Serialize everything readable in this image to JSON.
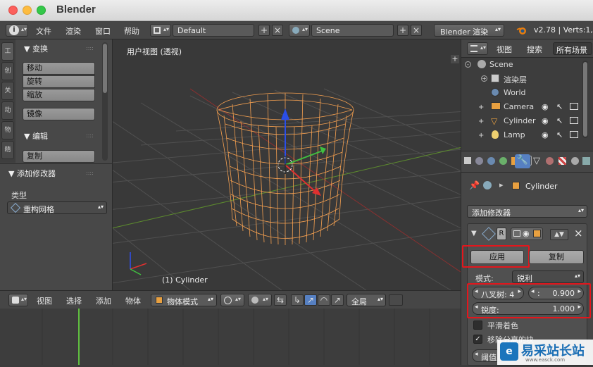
{
  "window": {
    "title": "Blender"
  },
  "info_header": {
    "menus": [
      "文件",
      "渲染",
      "窗口",
      "帮助"
    ],
    "screen_layout": "Default",
    "scene": "Scene",
    "render_engine": "Blender 渲染",
    "version_stats": "v2.78 | Verts:1,2"
  },
  "tool_shelf": {
    "tabs": [
      "工",
      "创",
      "关",
      "动",
      "物",
      "精"
    ],
    "transform_header": "变换",
    "transform_buttons": [
      "移动",
      "旋转",
      "缩放"
    ],
    "mirror_button": "镜像",
    "edit_header": "编辑",
    "duplicate_button": "复制",
    "add_modifier_header": "添加修改器",
    "type_label": "类型",
    "type_value": "重构网格"
  },
  "viewport": {
    "view_label": "用户视图 (透视)",
    "object_label": "(1) Cylinder"
  },
  "view3d_header": {
    "menus": [
      "视图",
      "选择",
      "添加",
      "物体"
    ],
    "mode": "物体模式",
    "pivot": "全局"
  },
  "outliner": {
    "view_menu": "视图",
    "search_menu": "搜索",
    "filter": "所有场景",
    "items": [
      "Scene",
      "渲染层",
      "World",
      "Camera",
      "Cylinder",
      "Lamp"
    ]
  },
  "properties": {
    "object_name": "Cylinder",
    "add_modifier": "添加修改器",
    "apply_button": "应用",
    "copy_button": "复制",
    "mode_label": "模式:",
    "mode_value": "锐利",
    "octree_label": "八叉树: 4",
    "scale_label": ":",
    "scale_value": "0.900",
    "sharpness_label": "锐度:",
    "sharpness_value": "1.000",
    "smooth_shading": "平滑着色",
    "remove_disconnected": "移除分离的块",
    "threshold": "阈值"
  },
  "watermark": {
    "text": "易采站长站",
    "url": "www.easck.com"
  },
  "colors": {
    "accent_red": "#e3161c",
    "wire_orange": "#f5a050",
    "selected_blue": "#5680c2"
  }
}
